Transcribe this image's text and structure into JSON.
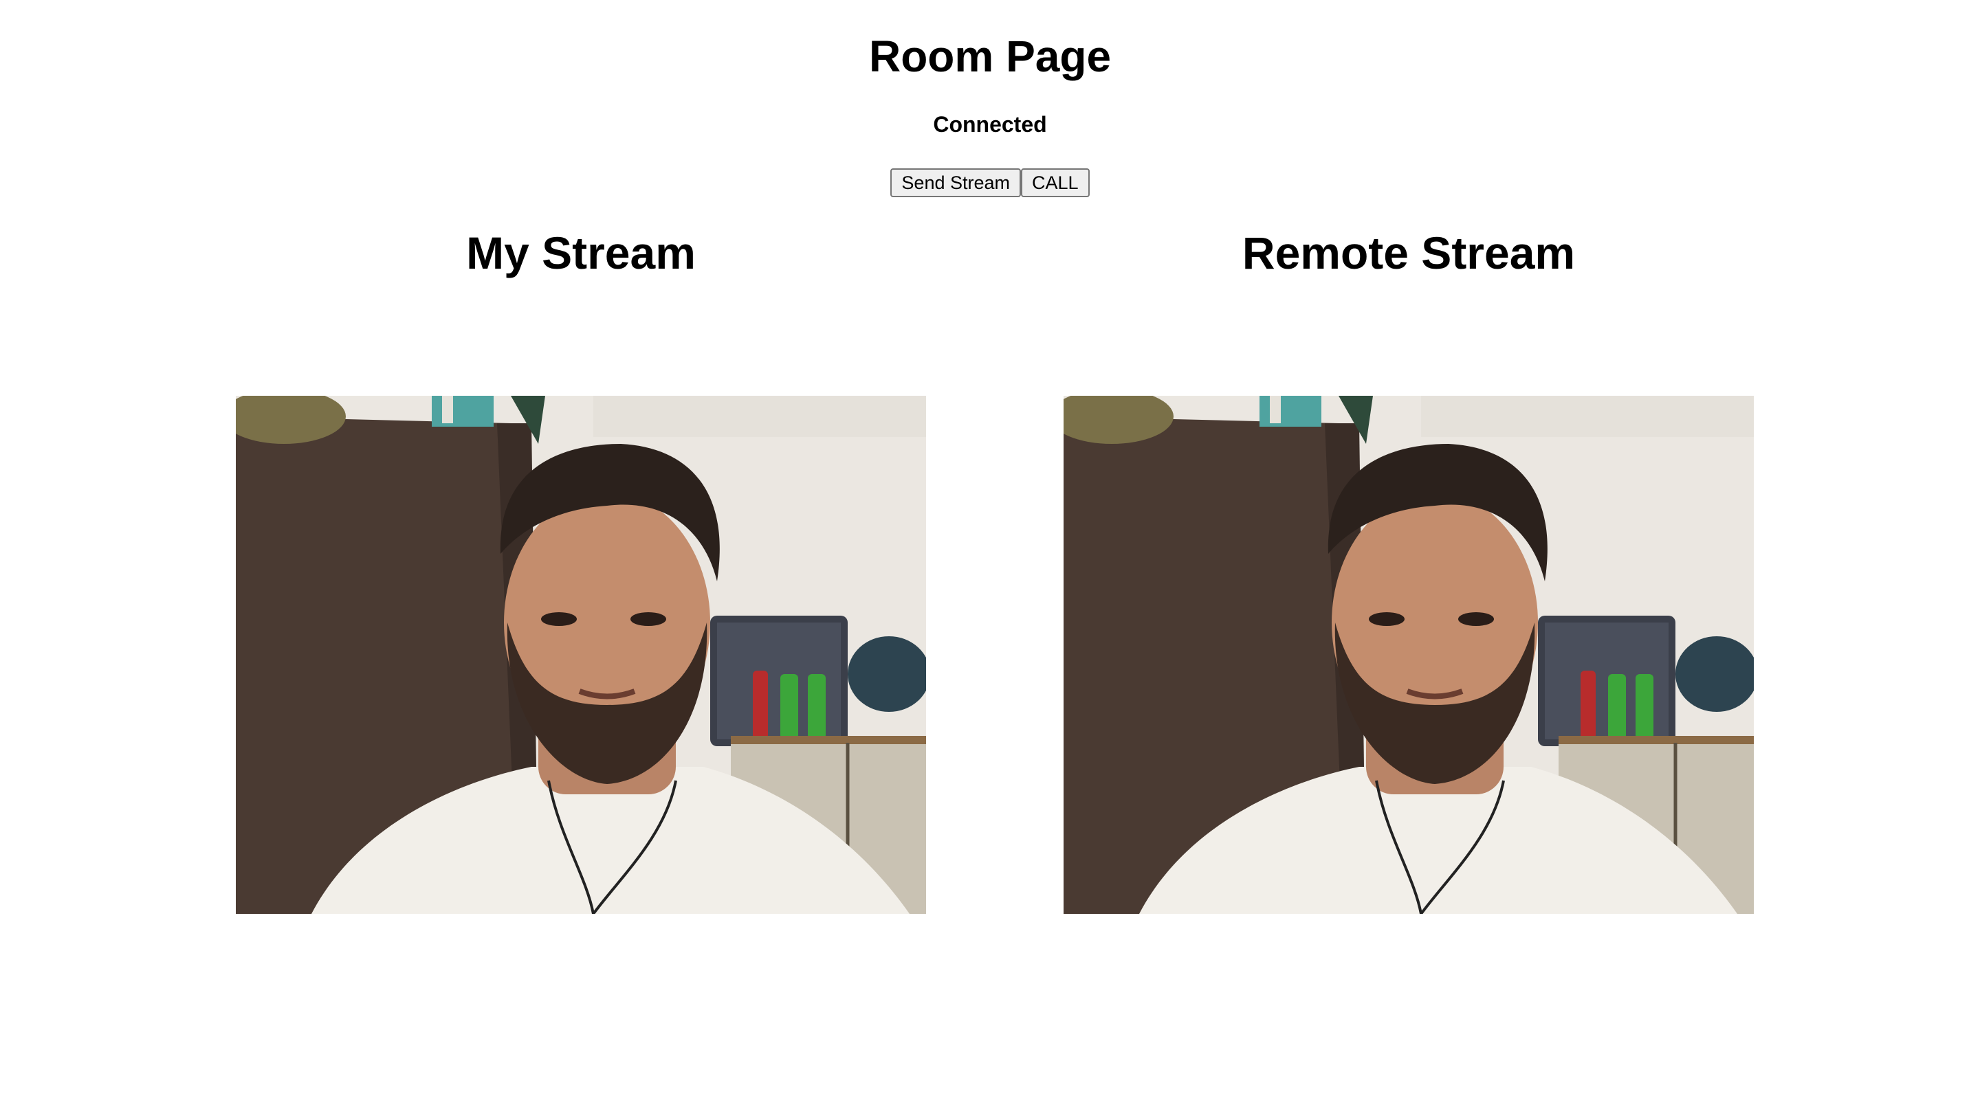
{
  "page": {
    "title": "Room Page",
    "status": "Connected"
  },
  "toolbar": {
    "send_stream_label": "Send Stream",
    "call_label": "CALL"
  },
  "streams": {
    "my_stream_heading": "My Stream",
    "remote_stream_heading": "Remote Stream"
  },
  "colors": {
    "background": "#ffffff",
    "text": "#000000",
    "button_bg": "#efefef",
    "button_border": "#767676"
  }
}
